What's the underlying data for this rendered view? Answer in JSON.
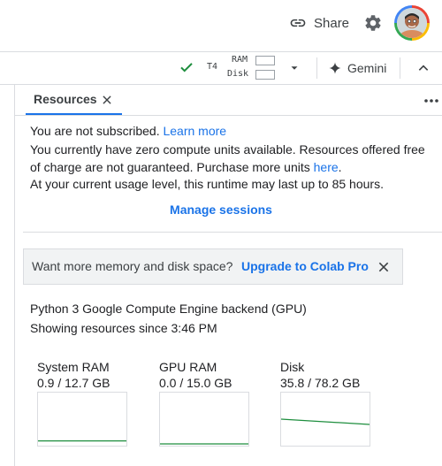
{
  "header": {
    "share_label": "Share"
  },
  "runtime": {
    "gpu_type": "T4",
    "ram_label": "RAM",
    "disk_label": "Disk",
    "ram_usage_fraction": 0.07,
    "disk_usage_fraction": 0.46,
    "gemini_label": "Gemini"
  },
  "panel": {
    "tab_label": "Resources",
    "not_subscribed": "You are not subscribed.",
    "learn_more": "Learn more",
    "units_text": "You currently have zero compute units available. Resources offered free of charge are not guaranteed. Purchase more units",
    "units_link": "here",
    "usage_text": "At your current usage level, this runtime may last up to 85 hours.",
    "manage_sessions": "Manage sessions",
    "upgrade_prompt": "Want more memory and disk space?",
    "upgrade_link": "Upgrade to Colab Pro",
    "backend": "Python 3 Google Compute Engine backend (GPU)",
    "since": "Showing resources since 3:46 PM"
  },
  "resources": [
    {
      "name": "System RAM",
      "value": "0.9 / 12.7 GB",
      "used": 0.9,
      "total": 12.7
    },
    {
      "name": "GPU RAM",
      "value": "0.0 / 15.0 GB",
      "used": 0.0,
      "total": 15.0
    },
    {
      "name": "Disk",
      "value": "35.8 / 78.2 GB",
      "used": 35.8,
      "total": 78.2
    }
  ],
  "colors": {
    "accent": "#1a73e8",
    "usage_line": "#1e8e3e",
    "success": "#1e8e3e"
  }
}
